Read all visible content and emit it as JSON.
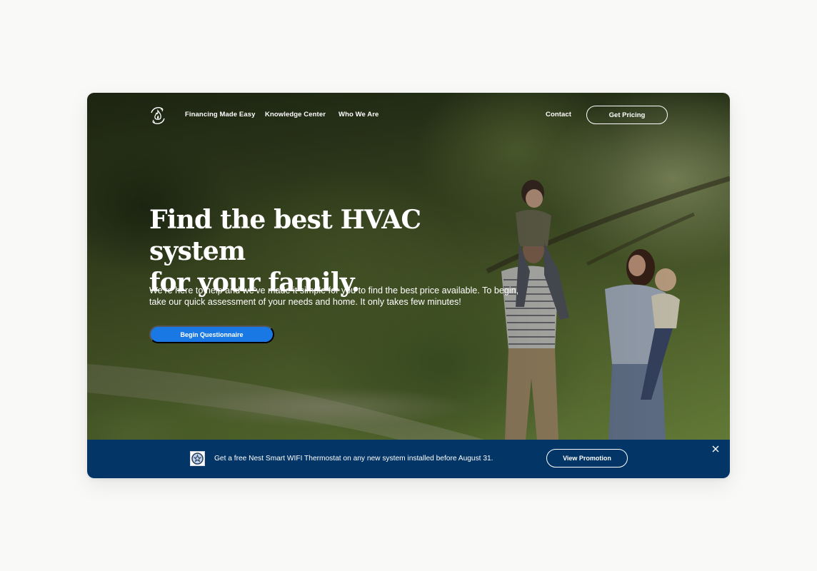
{
  "nav": {
    "logo": "flame-cycle-logo",
    "links": [
      {
        "label": "Financing Made Easy"
      },
      {
        "label": "Knowledge Center"
      },
      {
        "label": "Who We Are"
      }
    ],
    "contact_label": "Contact",
    "cta_label": "Get Pricing"
  },
  "hero": {
    "headline_line1": "Find the best HVAC system",
    "headline_line2": "for your family.",
    "subtext": "We’re here to help and we've made it simple for you to find the best price available. To begin, take our quick assessment of your needs and home. It only takes few minutes!",
    "cta_label": "Begin Questionnaire",
    "image": "family-walking-in-park-photo"
  },
  "promo": {
    "icon": "star-badge-icon",
    "text": "Get a free Nest Smart WIFI Thermostat on any new system installed before August 31.",
    "cta_label": "View Promotion",
    "close_icon": "close-icon"
  },
  "colors": {
    "page_bg": "#f9f9f7",
    "primary_button": "#1a78e5",
    "promo_bar": "#033566",
    "text_on_dark": "#ffffff"
  }
}
